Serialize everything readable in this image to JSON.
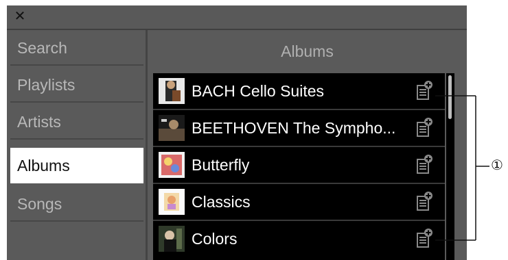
{
  "window": {
    "close_icon": "close-icon"
  },
  "sidebar": {
    "items": [
      {
        "label": "Search"
      },
      {
        "label": "Playlists"
      },
      {
        "label": "Artists"
      },
      {
        "label": "Albums",
        "active": true
      },
      {
        "label": "Songs"
      }
    ]
  },
  "content": {
    "title": "Albums",
    "albums": [
      {
        "title": "BACH Cello Suites"
      },
      {
        "title": "BEETHOVEN  The Sympho..."
      },
      {
        "title": "Butterfly"
      },
      {
        "title": "Classics"
      },
      {
        "title": "Colors"
      }
    ],
    "row_action_icon": "add-to-playlist-icon"
  },
  "annotation": {
    "label": "①"
  },
  "colors": {
    "background": "#5a5a5a",
    "list_background": "#000000",
    "active_item": "#ffffff",
    "inactive_text": "#b8b8b8"
  }
}
